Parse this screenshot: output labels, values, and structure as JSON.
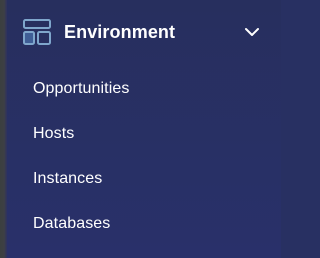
{
  "sidebar": {
    "section": {
      "title": "Environment",
      "icon": "layout-icon",
      "expanded": true
    },
    "items": [
      {
        "label": "Opportunities"
      },
      {
        "label": "Hosts"
      },
      {
        "label": "Instances"
      },
      {
        "label": "Databases"
      }
    ]
  },
  "colors": {
    "background": "#283062",
    "text": "#ffffff",
    "icon_stroke": "#7fa6cc",
    "icon_fill": "#3f5e96"
  }
}
